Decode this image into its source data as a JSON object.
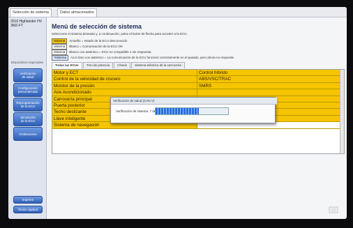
{
  "top_tabs": [
    "Selección de sistema",
    "Datos almacenados"
  ],
  "sidebar": {
    "vehicle": [
      "2016 Highlander HV",
      "ЗМZ-FT"
    ],
    "header": "Dispositivos especiales",
    "buttons": [
      [
        "Verificación",
        "de salud"
      ],
      [
        "Configuración",
        "personalizada"
      ],
      [
        "Reprogramación",
        "de la ECU"
      ],
      [
        "Simulación",
        "de la ECU"
      ],
      [
        "Grabaciones"
      ]
    ],
    "bottom_buttons": [
      "Imprimir",
      "Tomar captura"
    ]
  },
  "main": {
    "title": "Menú de selección de sistema",
    "instruction": "Seleccione el sistema deseado y, a continuación, pulse el botón de flecha para acceder a la ECU.",
    "legend": [
      {
        "swatch": "Sistema",
        "color": "#f6c500",
        "text": "Amarillo = estado de la ECU desconocido"
      },
      {
        "swatch": "Sistema",
        "color": "#ffffff",
        "text": "Blanco = Comunicación de la ECU OK"
      },
      {
        "swatch": "Sistema",
        "color": "#ffffff",
        "text": "Blanco con asterisco = ECU no compatible o sin respuesta"
      },
      {
        "swatch": "*Sistema",
        "color": "#d8e8ff",
        "text": "Azul claro con asterisco = La comunicación de la ECU funcionó correctamente en el pasado, pero ahora no responde"
      }
    ],
    "tabs": [
      "Todas las ECUs",
      "Tren de potencia",
      "Chasis",
      "Sistema eléctrico de la carrocería"
    ],
    "grid_rows": [
      [
        "Motor y ECT",
        "Control híbrido"
      ],
      [
        "Control de la velocidad de crucero",
        "ABS/VSC/TRAC"
      ],
      [
        "Monitor de la presión",
        "SMRS"
      ],
      [
        "Aire Acondicionado",
        ""
      ],
      [
        "Carrocería principal",
        ""
      ],
      [
        "Puerta posterior",
        ""
      ],
      [
        "Techo deslizante",
        "Panel de instrumentos"
      ],
      [
        "Llave inteligente",
        "Detección de ocupante"
      ],
      [
        "Sistema de navegación",
        ""
      ]
    ]
  },
  "modal": {
    "title": "Verificación de salud (CAN V)",
    "progress_text": "Verificación de sistema: 7 de 37",
    "progress_fraction": 0.6
  },
  "colors": {
    "row_yellow": "#f6c500",
    "accent_blue": "#2f5fb8"
  }
}
